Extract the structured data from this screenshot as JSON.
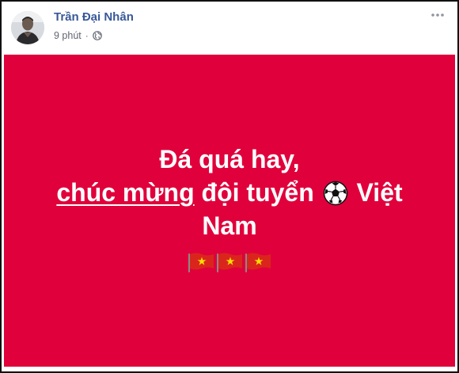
{
  "post": {
    "author": "Trần Đại Nhân",
    "time": "9 phút",
    "separator": "·",
    "privacy_icon": "globe-icon",
    "menu_icon": "more-horizontal-icon",
    "background_color": "#e0003b",
    "text_line1": "Đá quá hay,",
    "link_text": "chúc mừng",
    "text_line2_rest": " đội tuyển ",
    "ball_icon": "soccer-ball-icon",
    "text_line2_end": " Việt",
    "text_line3": "Nam",
    "flag_icons": [
      "vietnam-flag-icon",
      "vietnam-flag-icon",
      "vietnam-flag-icon"
    ]
  }
}
